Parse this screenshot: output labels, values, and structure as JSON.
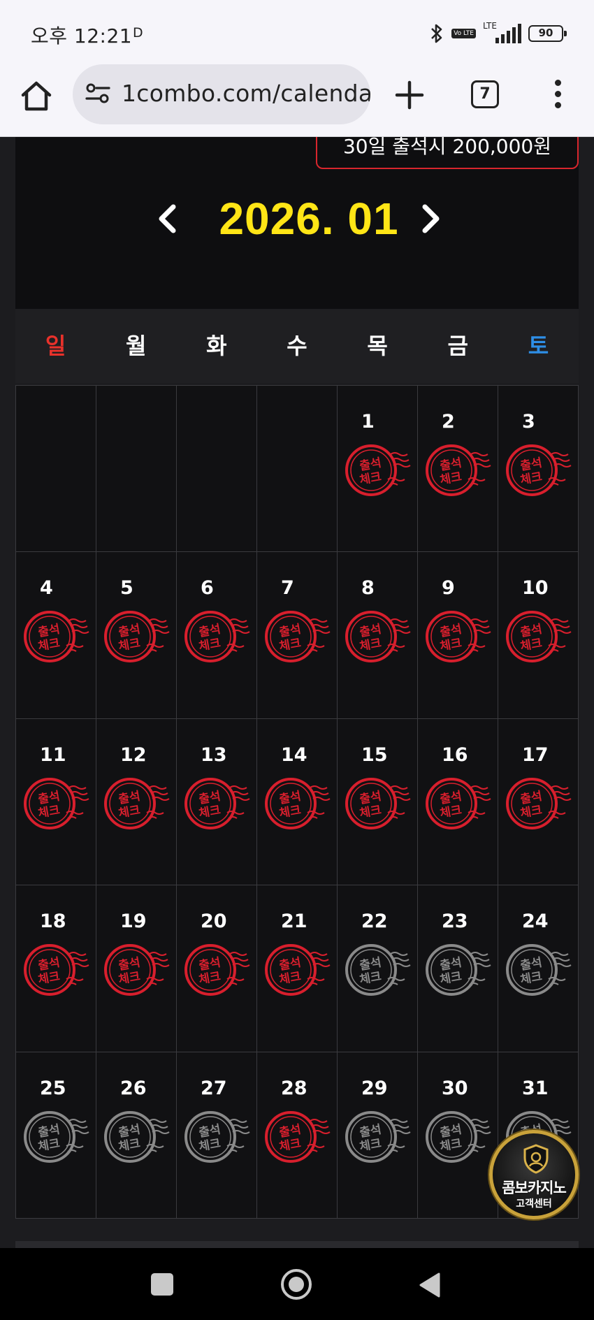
{
  "status_bar": {
    "time": "오후 12:21",
    "indicator": "D",
    "volte": "Vo LTE",
    "network": "LTE",
    "battery": "90"
  },
  "browser": {
    "url": "1combo.com/calenda",
    "tab_count": "7"
  },
  "page": {
    "reward_text": "30일 출석시 200,000원",
    "month_title": "2026. 01",
    "weekdays": [
      "일",
      "월",
      "화",
      "수",
      "목",
      "금",
      "토"
    ],
    "stamp_text": [
      "출석",
      "체크"
    ],
    "colors": {
      "accent_yellow": "#ffe516",
      "stamp_red": "#d81f2d",
      "stamp_gray": "#8a8a8a",
      "sunday": "#e8312b",
      "saturday": "#2e8ee6"
    },
    "days": [
      {
        "day": "",
        "stamp": "none"
      },
      {
        "day": "",
        "stamp": "none"
      },
      {
        "day": "",
        "stamp": "none"
      },
      {
        "day": "",
        "stamp": "none"
      },
      {
        "day": "1",
        "stamp": "checked"
      },
      {
        "day": "2",
        "stamp": "checked"
      },
      {
        "day": "3",
        "stamp": "checked"
      },
      {
        "day": "4",
        "stamp": "checked"
      },
      {
        "day": "5",
        "stamp": "checked"
      },
      {
        "day": "6",
        "stamp": "checked"
      },
      {
        "day": "7",
        "stamp": "checked"
      },
      {
        "day": "8",
        "stamp": "checked"
      },
      {
        "day": "9",
        "stamp": "checked"
      },
      {
        "day": "10",
        "stamp": "checked"
      },
      {
        "day": "11",
        "stamp": "checked"
      },
      {
        "day": "12",
        "stamp": "checked"
      },
      {
        "day": "13",
        "stamp": "checked"
      },
      {
        "day": "14",
        "stamp": "checked"
      },
      {
        "day": "15",
        "stamp": "checked"
      },
      {
        "day": "16",
        "stamp": "checked"
      },
      {
        "day": "17",
        "stamp": "checked"
      },
      {
        "day": "18",
        "stamp": "checked"
      },
      {
        "day": "19",
        "stamp": "checked"
      },
      {
        "day": "20",
        "stamp": "checked"
      },
      {
        "day": "21",
        "stamp": "checked"
      },
      {
        "day": "22",
        "stamp": "unchecked"
      },
      {
        "day": "23",
        "stamp": "unchecked"
      },
      {
        "day": "24",
        "stamp": "unchecked"
      },
      {
        "day": "25",
        "stamp": "unchecked"
      },
      {
        "day": "26",
        "stamp": "unchecked"
      },
      {
        "day": "27",
        "stamp": "unchecked"
      },
      {
        "day": "28",
        "stamp": "checked"
      },
      {
        "day": "29",
        "stamp": "unchecked"
      },
      {
        "day": "30",
        "stamp": "unchecked"
      },
      {
        "day": "31",
        "stamp": "unchecked"
      }
    ]
  },
  "cs_badge": {
    "line1": "콤보카지노",
    "line2": "고객센터"
  }
}
